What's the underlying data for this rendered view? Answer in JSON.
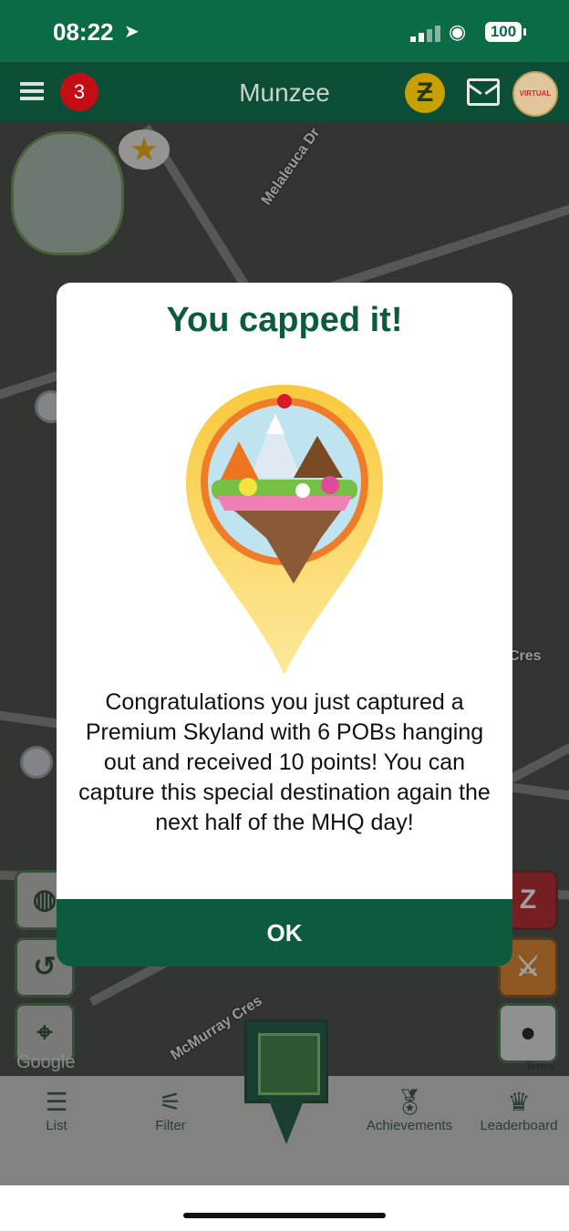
{
  "status": {
    "time": "08:22",
    "battery": "100"
  },
  "topbar": {
    "notification_count": "3",
    "title": "Munzee",
    "zcoin_symbol": "Ƶ",
    "avatar_text": "VIRTUAL"
  },
  "map": {
    "labels": {
      "street1": "Melaleuca Dr",
      "street2": "McMurray Cres",
      "cres": "Cres",
      "google": "Google",
      "terms": "Terms"
    }
  },
  "dialog": {
    "title": "You capped it!",
    "message": "Congratulations you just captured a Premium Skyland with 6 POBs hanging out and received 10 points! You can capture this special destination again the next half of the MHQ day!",
    "ok_label": "OK"
  },
  "bottom_nav": {
    "items": [
      {
        "label": "List"
      },
      {
        "label": "Filter"
      },
      {
        "label": "Achievements"
      },
      {
        "label": "Leaderboard"
      }
    ]
  }
}
